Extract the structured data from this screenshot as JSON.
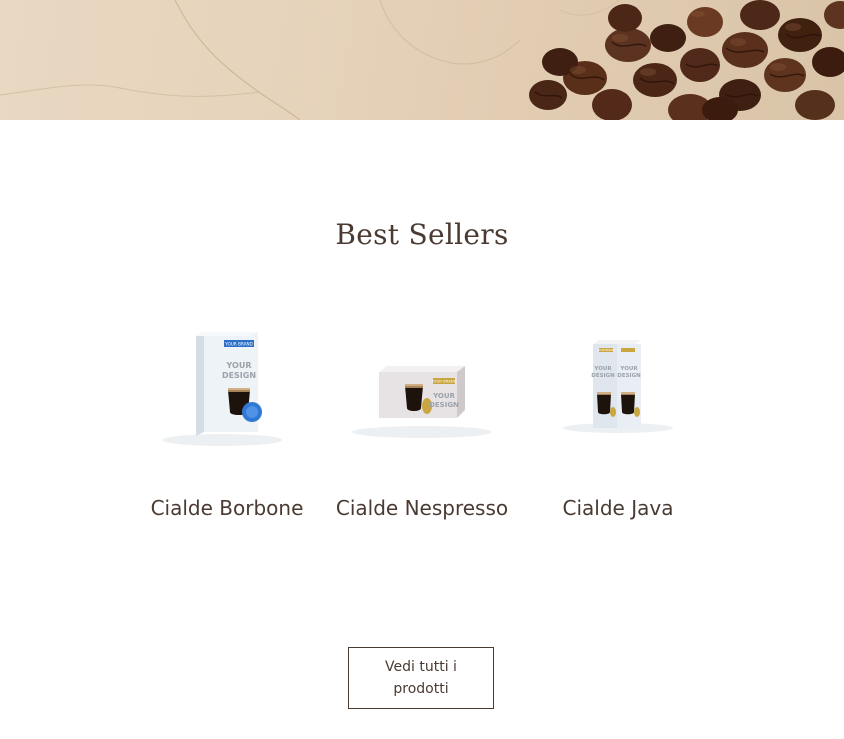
{
  "hero": {
    "image": "coffee-beans-marble-banner"
  },
  "section": {
    "title": "Best Sellers"
  },
  "products": [
    {
      "name": "Cialde Borbone",
      "image": "borbone-box-mockup",
      "brand_label": "YOUR BRAND",
      "design_label": "YOUR DESIGN",
      "accent": "#2a6fc9"
    },
    {
      "name": "Cialde Nespresso",
      "image": "nespresso-box-mockup",
      "brand_label": "YOUR BRAND",
      "design_label": "YOUR DESIGN",
      "accent": "#c9a640"
    },
    {
      "name": "Cialde Java",
      "image": "java-box-mockup",
      "brand_label": "YOUR BRAND",
      "design_label": "YOUR DESIGN",
      "accent": "#c9a640"
    }
  ],
  "cta": {
    "label": "Vedi tutti i prodotti"
  },
  "colors": {
    "text": "#4a3a32",
    "background": "#ffffff"
  }
}
